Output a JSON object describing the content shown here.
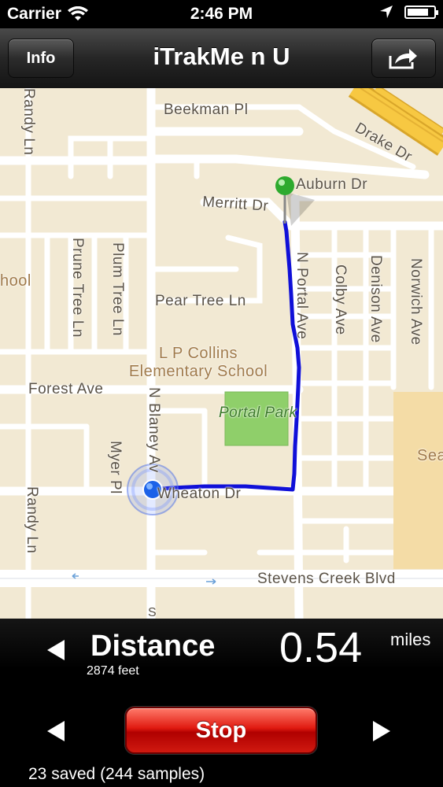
{
  "status_bar": {
    "carrier": "Carrier",
    "time": "2:46 PM",
    "battery_level": 0.8,
    "icons": [
      "wifi-icon",
      "location-arrow-icon",
      "battery-icon"
    ]
  },
  "nav": {
    "title": "iTrakMe n U",
    "info_label": "Info",
    "share_icon": "share-icon"
  },
  "map": {
    "streets": {
      "beekman": "Beekman Pl",
      "drake": "Drake Dr",
      "auburn": "Auburn Dr",
      "merritt": "Merritt Dr",
      "pear_tree": "Pear Tree Ln",
      "forest": "Forest Ave",
      "wheaton": "Wheaton Dr",
      "stevens_creek": "Stevens Creek Blvd",
      "randy_top": "Randy Ln",
      "randy_bottom": "Randy Ln",
      "prune_tree": "Prune Tree Ln",
      "plum_tree": "Plum Tree Ln",
      "myer": "Myer Pl",
      "n_blaney": "N Blaney Av",
      "n_portal": "N Portal Ave",
      "colby": "Colby Ave",
      "denison": "Denison Ave",
      "norwich": "Norwich Ave",
      "blaney_fragment": "S"
    },
    "pois": {
      "school_left": "hool",
      "school_name": "L P Collins",
      "school_name_2": "Elementary School",
      "park": "Portal Park",
      "right_edge": "Sea"
    },
    "colors": {
      "route": "#1010d8",
      "land": "#f2e9d3",
      "road": "#ffffff",
      "park": "#8fcf6a",
      "highway": "#f7c842"
    }
  },
  "stats": {
    "label": "Distance",
    "sub": "2874 feet",
    "value": "0.54",
    "unit": "miles"
  },
  "controls": {
    "stop_label": "Stop",
    "prev_icon": "arrow-left-icon",
    "next_icon": "arrow-right-icon"
  },
  "footer": {
    "saved_text": "23 saved (244 samples)"
  }
}
